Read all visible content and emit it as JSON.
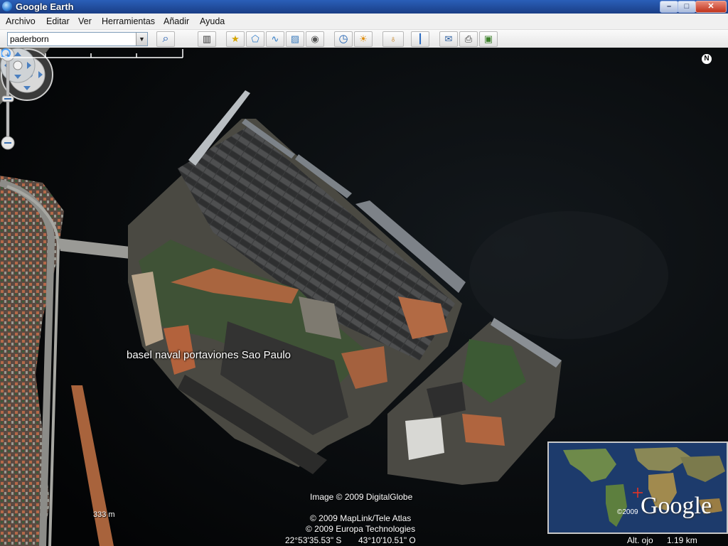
{
  "window": {
    "title": "Google Earth",
    "min_label": "–",
    "max_label": "□",
    "close_label": "✕"
  },
  "menu": [
    "Archivo",
    "Editar",
    "Ver",
    "Herramientas",
    "Añadir",
    "Ayuda"
  ],
  "toolbar": {
    "search_value": "paderborn",
    "dropdown_glyph": "▼",
    "buttons": [
      {
        "name": "search-button",
        "glyph": "⌕"
      },
      {
        "name": "sidebar-toggle-button",
        "glyph": "▥"
      },
      {
        "name": "add-placemark-button",
        "glyph": "★"
      },
      {
        "name": "add-polygon-button",
        "glyph": "⬠"
      },
      {
        "name": "add-path-button",
        "glyph": "∿"
      },
      {
        "name": "add-image-overlay-button",
        "glyph": "▨"
      },
      {
        "name": "record-tour-button",
        "glyph": "◉"
      },
      {
        "name": "historical-imagery-button",
        "glyph": "◷"
      },
      {
        "name": "sunlight-button",
        "glyph": "☀"
      },
      {
        "name": "switch-planet-button",
        "glyph": "♁"
      },
      {
        "name": "ruler-button",
        "glyph": "┃"
      },
      {
        "name": "email-button",
        "glyph": "✉"
      },
      {
        "name": "print-button",
        "glyph": "⎙"
      },
      {
        "name": "view-in-maps-button",
        "glyph": "▣"
      }
    ]
  },
  "map": {
    "placemark": {
      "label": "basel naval portaviones Sao Paulo"
    },
    "compass_letter": "N",
    "attribution": {
      "imagery": "Image © 2009 DigitalGlobe",
      "maplink": "© 2009 MapLink/Tele Atlas",
      "europa": "© 2009 Europa Technologies"
    },
    "scale": "333 m",
    "coordinates": {
      "lat": "22°53'35.53\" S",
      "lon": "43°10'10.51\" O"
    },
    "eye_alt_label": "Alt. ojo",
    "eye_alt_value": "1.19 km",
    "overview": {
      "brand": "Google",
      "copyright": "©2009"
    }
  }
}
